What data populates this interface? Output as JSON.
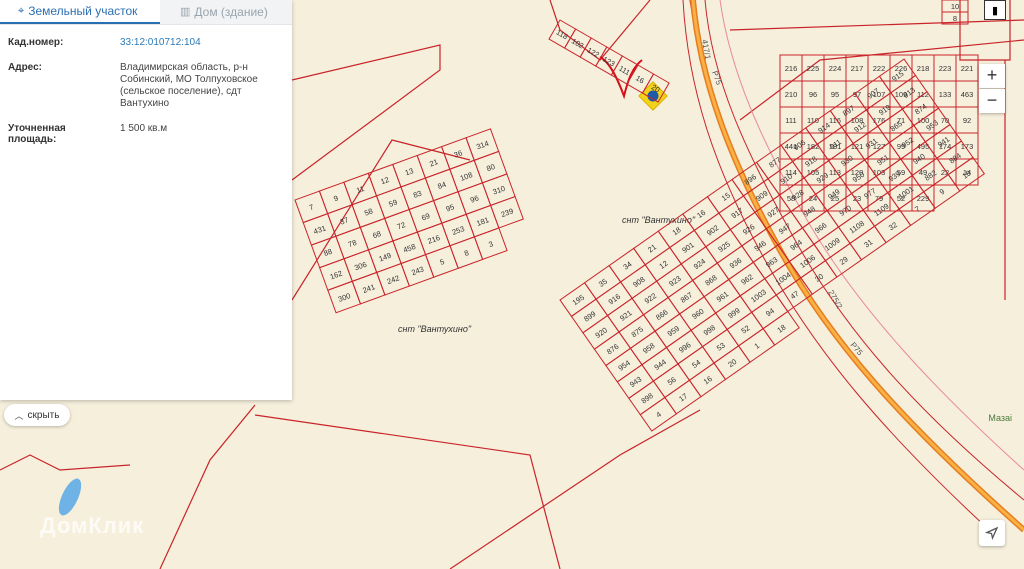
{
  "tabs": {
    "land": "Земельный участок",
    "house": "Дом (здание)"
  },
  "info": {
    "cadastral_label": "Кад.номер:",
    "cadastral_value": "33:12:010712:104",
    "address_label": "Адрес:",
    "address_value": "Владимирская область, р-н Собинский, МО Толпуховское (сельское поселение), сдт Вантухино",
    "area_label": "Уточненная площадь:",
    "area_value": "1 500 кв.м"
  },
  "controls": {
    "collapse": "скрыть",
    "zoom_in": "+",
    "zoom_out": "−"
  },
  "watermark": "ДомКлик",
  "map": {
    "settlement_label": "снт \"Вантухино\"",
    "settlement_label_2": "снт \"Вантухино\"",
    "road_labels": [
      "417/1",
      "Р75",
      "275/2",
      "Р75"
    ],
    "top_right_numbers": [
      "10",
      "8"
    ],
    "misc_label": "Мазаі",
    "parcel_numbers_right_block": [
      "216",
      "225",
      "224",
      "217",
      "222",
      "226",
      "218",
      "223",
      "221",
      "210",
      "96",
      "95",
      "97",
      "107",
      "109",
      "112",
      "133",
      "463",
      "111",
      "110",
      "116",
      "108",
      "176",
      "71",
      "100",
      "70",
      "92",
      "441",
      "182",
      "181",
      "121",
      "127",
      "99",
      "495",
      "174",
      "173",
      "114",
      "105",
      "113",
      "120",
      "103",
      "59",
      "49",
      "22",
      "14",
      "58",
      "24",
      "25",
      "23",
      "79",
      "52",
      "229"
    ],
    "parcel_numbers_top": [
      "118",
      "102",
      "122",
      "123",
      "111",
      "16",
      "20"
    ],
    "parcel_numbers_center_left": [
      "7",
      "9",
      "11",
      "12",
      "13",
      "21",
      "36",
      "314",
      "431",
      "37",
      "58",
      "59",
      "83",
      "84",
      "108",
      "80",
      "88",
      "78",
      "68",
      "72",
      "69",
      "95",
      "96",
      "310",
      "162",
      "306",
      "149",
      "458",
      "216",
      "253",
      "181",
      "239",
      "300",
      "241",
      "242",
      "243",
      "5",
      "8",
      "3"
    ],
    "parcel_numbers_bottom": [
      "195",
      "35",
      "34",
      "21",
      "18",
      "16",
      "15",
      "896",
      "877",
      "906",
      "914",
      "897",
      "907",
      "915",
      "899",
      "916",
      "908",
      "12",
      "901",
      "902",
      "917",
      "909",
      "910",
      "918",
      "911",
      "912",
      "919",
      "913",
      "920",
      "921",
      "922",
      "923",
      "924",
      "925",
      "926",
      "927",
      "928",
      "929",
      "930",
      "931",
      "865",
      "874",
      "876",
      "875",
      "866",
      "867",
      "868",
      "936",
      "946",
      "947",
      "948",
      "949",
      "950",
      "951",
      "952",
      "953",
      "954",
      "958",
      "959",
      "960",
      "961",
      "962",
      "963",
      "964",
      "966",
      "970",
      "977",
      "939",
      "940",
      "941",
      "943",
      "944",
      "996",
      "998",
      "999",
      "1003",
      "1004",
      "1006",
      "1009",
      "1108",
      "1109",
      "1001",
      "882",
      "884",
      "898",
      "56",
      "54",
      "53",
      "52",
      "94",
      "47",
      "30",
      "29",
      "31",
      "32",
      "7",
      "9",
      "10",
      "4",
      "17",
      "16",
      "20",
      "1",
      "18"
    ]
  }
}
